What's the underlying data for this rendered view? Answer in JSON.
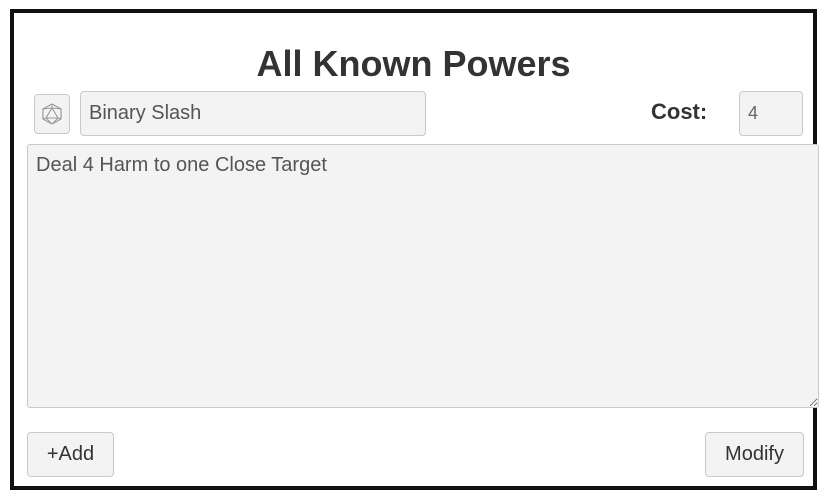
{
  "panel": {
    "title": "All Known Powers"
  },
  "power": {
    "dice_icon": "d20-dice-icon",
    "name_value": "Binary Slash",
    "cost_label": "Cost:",
    "cost_value": "4",
    "description_value": "Deal 4 Harm to one Close Target"
  },
  "actions": {
    "add_label": "+Add",
    "modify_label": "Modify"
  }
}
